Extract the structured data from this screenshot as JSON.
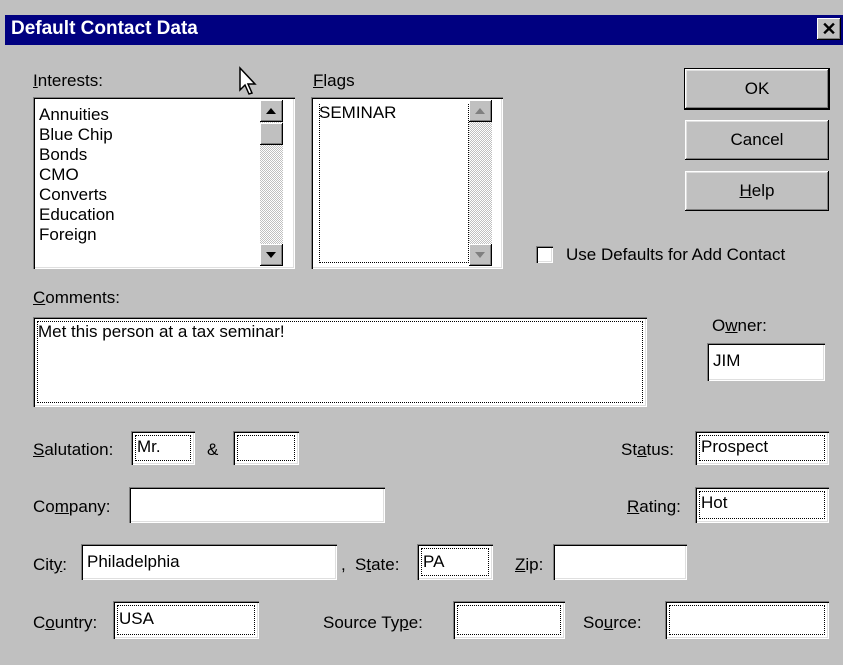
{
  "window": {
    "title": "Default Contact Data",
    "close_glyph": "✕"
  },
  "interests": {
    "label_pre": "",
    "label_key": "I",
    "label_post": "nterests:",
    "items": [
      "Annuities",
      "Blue Chip",
      "Bonds",
      "CMO",
      "Converts",
      "Education",
      "Foreign"
    ]
  },
  "flags": {
    "label_pre": "",
    "label_key": "F",
    "label_post": "lags",
    "items": [
      "SEMINAR"
    ]
  },
  "buttons": {
    "ok": "OK",
    "cancel": "Cancel",
    "help_key": "H",
    "help_post": "elp"
  },
  "use_defaults": {
    "label": "Use Defaults for Add Contact",
    "checked": false
  },
  "comments": {
    "label_pre": "",
    "label_key": "C",
    "label_post": "omments:",
    "value": "Met this person at a tax seminar!"
  },
  "owner": {
    "label_pre": "O",
    "label_key": "w",
    "label_post": "ner:",
    "value": "JIM"
  },
  "salutation": {
    "label_pre": "",
    "label_key": "S",
    "label_post": "alutation:",
    "value": "Mr.",
    "amp": "&",
    "value2": ""
  },
  "status": {
    "label_pre": "St",
    "label_key": "a",
    "label_post": "tus:",
    "value": "Prospect"
  },
  "company": {
    "label_pre": "Co",
    "label_key": "m",
    "label_post": "pany:",
    "value": ""
  },
  "rating": {
    "label_pre": "",
    "label_key": "R",
    "label_post": "ating:",
    "value": "Hot"
  },
  "city": {
    "label_pre": "Cit",
    "label_key": "y",
    "label_post": ":",
    "value": "Philadelphia",
    "comma": ","
  },
  "state": {
    "label_pre": "S",
    "label_key": "t",
    "label_post": "ate:",
    "value": "PA"
  },
  "zip": {
    "label_pre": "",
    "label_key": "Z",
    "label_post": "ip:",
    "value": ""
  },
  "country": {
    "label_pre": "C",
    "label_key": "o",
    "label_post": "untry:",
    "value": "USA"
  },
  "source_type": {
    "label_pre": "Source Ty",
    "label_key": "p",
    "label_post": "e:",
    "value": ""
  },
  "source": {
    "label_pre": "So",
    "label_key": "u",
    "label_post": "rce:",
    "value": ""
  },
  "icons": {
    "cursor": "arrow-cursor-icon"
  }
}
